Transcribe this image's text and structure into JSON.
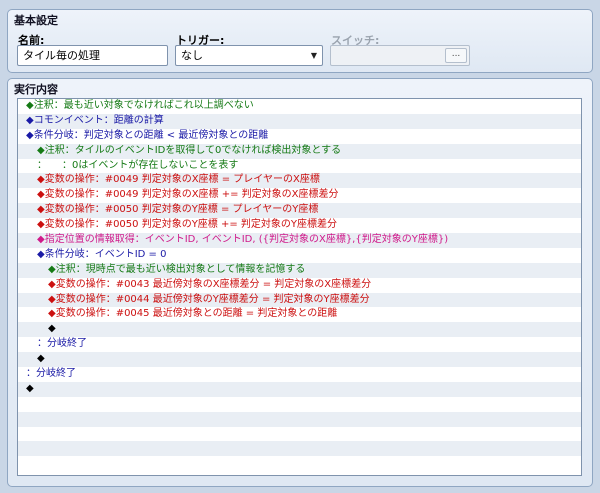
{
  "basic": {
    "title": "基本設定",
    "name_label": "名前:",
    "name_value": "タイル毎の処理",
    "trigger_label": "トリガー:",
    "trigger_value": "なし",
    "switch_label": "スイッチ:",
    "switch_button": "..."
  },
  "exec": {
    "title": "実行内容",
    "rows": [
      {
        "indent": 0,
        "color": "green",
        "text": "◆注釈：最も近い対象でなければこれ以上調べない"
      },
      {
        "indent": 0,
        "color": "blue",
        "text": "◆コモンイベント：距離の計算"
      },
      {
        "indent": 0,
        "color": "blue",
        "text": "◆条件分岐：判定対象との距離 < 最近傍対象との距離"
      },
      {
        "indent": 1,
        "color": "green",
        "text": "◆注釈：タイルのイベントIDを取得して0でなければ検出対象とする"
      },
      {
        "indent": 1,
        "color": "green",
        "text": "：　　：0はイベントが存在しないことを表す"
      },
      {
        "indent": 1,
        "color": "red",
        "text": "◆変数の操作：#0049 判定対象のX座標 = プレイヤーのX座標"
      },
      {
        "indent": 1,
        "color": "red",
        "text": "◆変数の操作：#0049 判定対象のX座標 += 判定対象のX座標差分"
      },
      {
        "indent": 1,
        "color": "red",
        "text": "◆変数の操作：#0050 判定対象のY座標 = プレイヤーのY座標"
      },
      {
        "indent": 1,
        "color": "red",
        "text": "◆変数の操作：#0050 判定対象のY座標 += 判定対象のY座標差分"
      },
      {
        "indent": 1,
        "color": "pink",
        "text": "◆指定位置の情報取得：イベントID, イベントID, ({判定対象のX座標},{判定対象のY座標})"
      },
      {
        "indent": 1,
        "color": "blue",
        "text": "◆条件分岐：イベントID = 0"
      },
      {
        "indent": 2,
        "color": "green",
        "text": "◆注釈：現時点で最も近い検出対象として情報を記憶する"
      },
      {
        "indent": 2,
        "color": "red",
        "text": "◆変数の操作：#0043 最近傍対象のX座標差分 = 判定対象のX座標差分"
      },
      {
        "indent": 2,
        "color": "red",
        "text": "◆変数の操作：#0044 最近傍対象のY座標差分 = 判定対象のY座標差分"
      },
      {
        "indent": 2,
        "color": "red",
        "text": "◆変数の操作：#0045 最近傍対象との距離 = 判定対象との距離"
      },
      {
        "indent": 2,
        "color": "black",
        "text": "◆"
      },
      {
        "indent": 1,
        "color": "blue",
        "text": "：分岐終了"
      },
      {
        "indent": 1,
        "color": "black",
        "text": "◆"
      },
      {
        "indent": 0,
        "color": "blue",
        "text": "：分岐終了"
      },
      {
        "indent": 0,
        "color": "black",
        "text": "◆"
      },
      {
        "indent": 0,
        "color": "black",
        "text": ""
      },
      {
        "indent": 0,
        "color": "black",
        "text": ""
      },
      {
        "indent": 0,
        "color": "black",
        "text": ""
      },
      {
        "indent": 0,
        "color": "black",
        "text": ""
      },
      {
        "indent": 0,
        "color": "black",
        "text": ""
      }
    ]
  }
}
